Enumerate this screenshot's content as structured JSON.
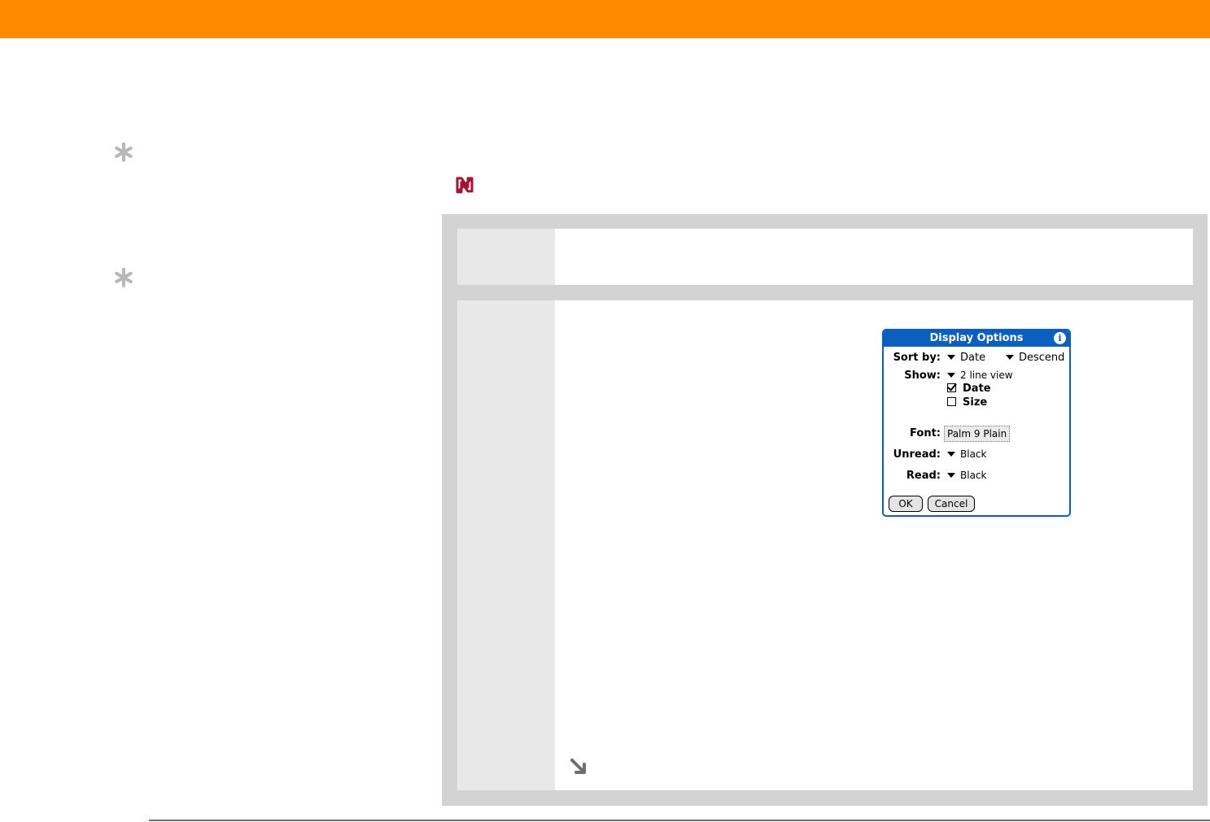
{
  "colors": {
    "accent_bar": "#ff8a00",
    "dialog_blue": "#0a5fbf",
    "tip_icon": "#b7b7b7",
    "note_icon": "#a3142e"
  },
  "icons": {
    "tip": "asterisk-icon",
    "note": "note-icon",
    "continue": "continue-arrow-icon",
    "info": "info-icon"
  },
  "dialog": {
    "title": "Display Options",
    "info_glyph": "i",
    "sort_by": {
      "label": "Sort by:",
      "field": "Date",
      "order": "Descend"
    },
    "show": {
      "label": "Show:",
      "view": "2 line view",
      "options": [
        {
          "label": "Date",
          "checked": true
        },
        {
          "label": "Size",
          "checked": false
        }
      ]
    },
    "font": {
      "label": "Font:",
      "value": "Palm 9 Plain"
    },
    "unread": {
      "label": "Unread:",
      "value": "Black"
    },
    "read": {
      "label": "Read:",
      "value": "Black"
    },
    "buttons": {
      "ok": "OK",
      "cancel": "Cancel"
    }
  }
}
